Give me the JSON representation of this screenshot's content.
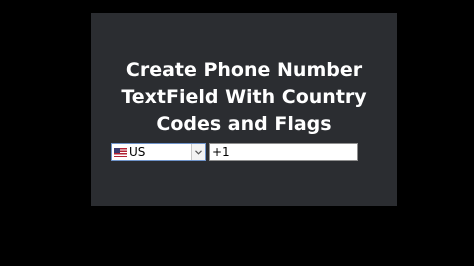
{
  "heading": {
    "line1": "Create Phone Number",
    "line2": "TextField With Country",
    "line3": "Codes and Flags"
  },
  "phone_field": {
    "country_select": {
      "selected_label": "US",
      "flag_icon": "us-flag-icon"
    },
    "number_input": {
      "value": "+1"
    }
  },
  "colors": {
    "page_background": "#000000",
    "panel_background": "#2b2d31",
    "heading_text": "#ffffff",
    "select_focus_border": "#6f93c9"
  }
}
